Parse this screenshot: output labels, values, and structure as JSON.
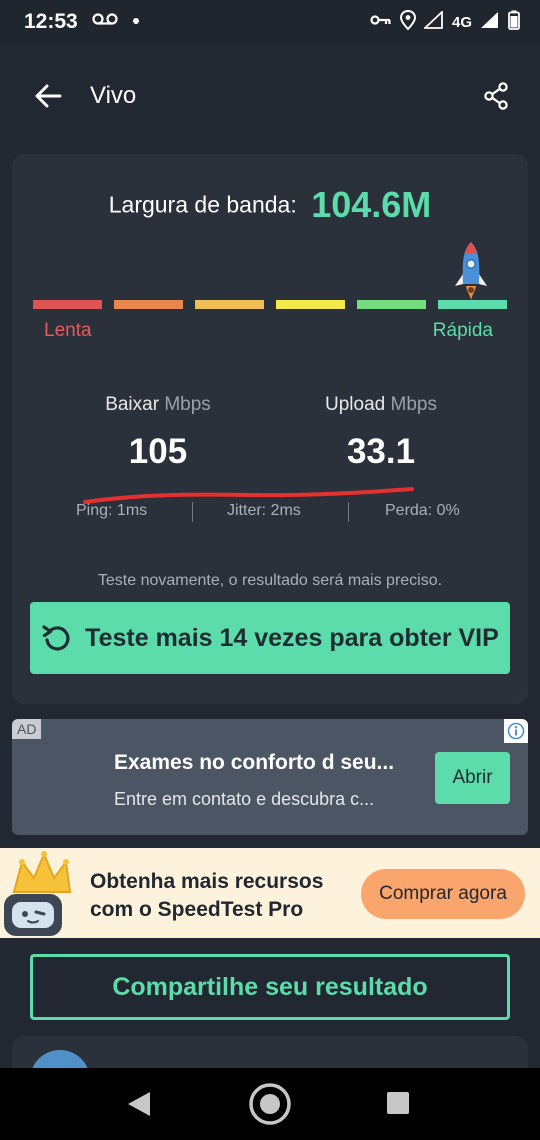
{
  "status_bar": {
    "time": "12:53",
    "network": "4G",
    "icons": [
      "voicemail-icon",
      "notification-dot-icon",
      "vpn-key-icon",
      "location-icon",
      "signal-icon",
      "battery-icon"
    ]
  },
  "app_bar": {
    "title": "Vivo",
    "back_icon": "arrow-left-icon",
    "share_icon": "share-icon"
  },
  "result": {
    "bandwidth_label": "Largura de banda:",
    "bandwidth_value": "104.6M",
    "scale": {
      "slow_label": "Lenta",
      "fast_label": "Rápida",
      "segment_colors": [
        "#de5454",
        "#e8884f",
        "#efbf55",
        "#f2ea4a",
        "#75dd7d",
        "#5cdcaa"
      ],
      "indicator_icon": "rocket-icon",
      "level_segment": 6
    },
    "download": {
      "label": "Baixar",
      "unit": "Mbps",
      "value": "105"
    },
    "upload": {
      "label": "Upload",
      "unit": "Mbps",
      "value": "33.1"
    },
    "ping": "Ping: 1ms",
    "jitter": "Jitter: 2ms",
    "loss": "Perda: 0%",
    "hint": "Teste novamente, o resultado será mais preciso.",
    "vip_button": "Teste mais 14 vezes para obter VIP",
    "vip_icon": "retry-icon"
  },
  "ad": {
    "tag": "AD",
    "title": "Exames no conforto d seu...",
    "description": "Entre em contato e descubra c...",
    "open_button": "Abrir"
  },
  "pro_banner": {
    "line1": "Obtenha mais recursos",
    "line2": "com o SpeedTest Pro",
    "buy_button": "Comprar agora"
  },
  "share_button": "Compartilhe seu resultado",
  "colors": {
    "accent": "#5cdcaa",
    "background": "#222831",
    "card": "#2b313a",
    "slow": "#e9595a",
    "banner": "#fdf3dd",
    "buy_button": "#f9a56c"
  }
}
